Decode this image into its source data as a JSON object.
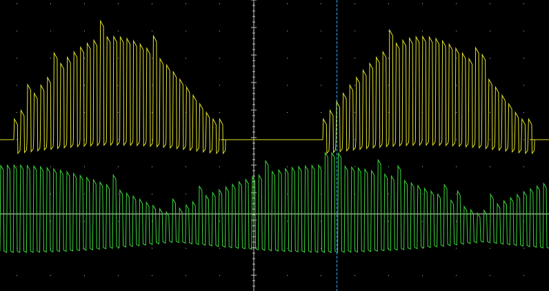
{
  "colors": {
    "background": "#000000",
    "graticule": "#c8c8c8",
    "channel_1": "#e6e62a",
    "channel_2": "#3ddc3d",
    "cursor": "#2aa8ff"
  },
  "traces": [
    {
      "name": "",
      "color_key": "channel_1"
    },
    {
      "name": "",
      "color_key": "channel_2"
    }
  ],
  "cursor": {
    "style": "dashed-vertical"
  },
  "display": {
    "grid": "dotted",
    "center_axis": "tick-marks"
  }
}
